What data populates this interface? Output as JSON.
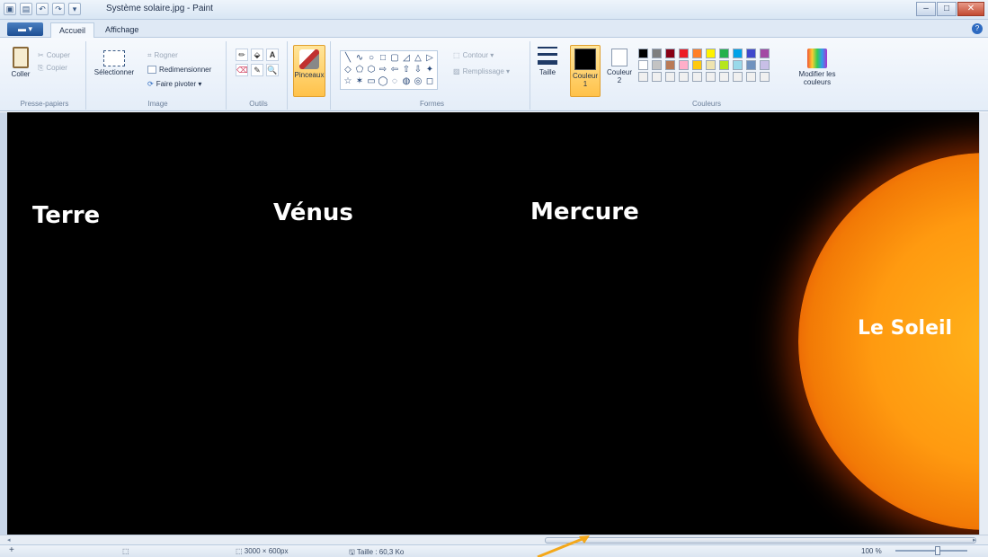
{
  "window": {
    "title": "Système solaire.jpg - Paint",
    "minimize": "–",
    "maximize": "□",
    "close": "✕"
  },
  "qat": {
    "icons": [
      "paint-icon",
      "save-icon",
      "undo-icon",
      "redo-icon"
    ],
    "dropdown": "▾"
  },
  "tabs": {
    "menu": "▬ ▾",
    "accueil": "Accueil",
    "affichage": "Affichage",
    "help": "?"
  },
  "ribbon": {
    "clipboard": {
      "paste": "Coller",
      "cut": "Couper",
      "copy": "Copier",
      "label": "Presse-papiers"
    },
    "image": {
      "select": "Sélectionner",
      "crop": "Rogner",
      "resize": "Redimensionner",
      "rotate": "Faire pivoter ▾",
      "label": "Image"
    },
    "tools": {
      "label": "Outils",
      "glyphs": [
        "✏",
        "⬙",
        "A",
        "⌫",
        "✎",
        "🔍"
      ]
    },
    "brush": {
      "label": "Pinceaux"
    },
    "shapes": {
      "label": "Formes",
      "outline": "Contour ▾",
      "fill": "Remplissage ▾",
      "glyphs": [
        "╲",
        "∿",
        "○",
        "□",
        "▢",
        "◿",
        "△",
        "▷",
        "◇",
        "⬠",
        "⬡",
        "⇨",
        "⇦",
        "⇧",
        "⇩",
        "✦",
        "☆",
        "✶",
        "▭",
        "◯",
        "◌",
        "◍",
        "◎",
        "◻"
      ]
    },
    "size": {
      "label": "Taille"
    },
    "colors": {
      "label": "Couleurs",
      "color1": "Couleur 1",
      "color2": "Couleur 2",
      "edit": "Modifier les couleurs",
      "palette": [
        "#000000",
        "#7f7f7f",
        "#880015",
        "#ed1c24",
        "#ff7f27",
        "#fff200",
        "#22b14c",
        "#00a2e8",
        "#3f48cc",
        "#a349a4",
        "#ffffff",
        "#c3c3c3",
        "#b97a57",
        "#ffaec9",
        "#ffc90e",
        "#efe4b0",
        "#b5e61d",
        "#99d9ea",
        "#7092be",
        "#c8bfe7",
        "#f0f0f0",
        "#f0f0f0",
        "#f0f0f0",
        "#f0f0f0",
        "#f0f0f0",
        "#f0f0f0",
        "#f0f0f0",
        "#f0f0f0",
        "#f0f0f0",
        "#f0f0f0"
      ]
    }
  },
  "canvas": {
    "labels": {
      "terre": "Terre",
      "venus": "Vénus",
      "mercure": "Mercure",
      "soleil": "Le Soleil"
    }
  },
  "status": {
    "add_icon": "+",
    "selection_icon": "⬚",
    "dimensions": "⬚ 3000 × 600px",
    "size": "🖫 Taille : 60,3 Ko",
    "zoom": "100 %"
  },
  "accent": {
    "arrow_color": "#f4a81a"
  }
}
